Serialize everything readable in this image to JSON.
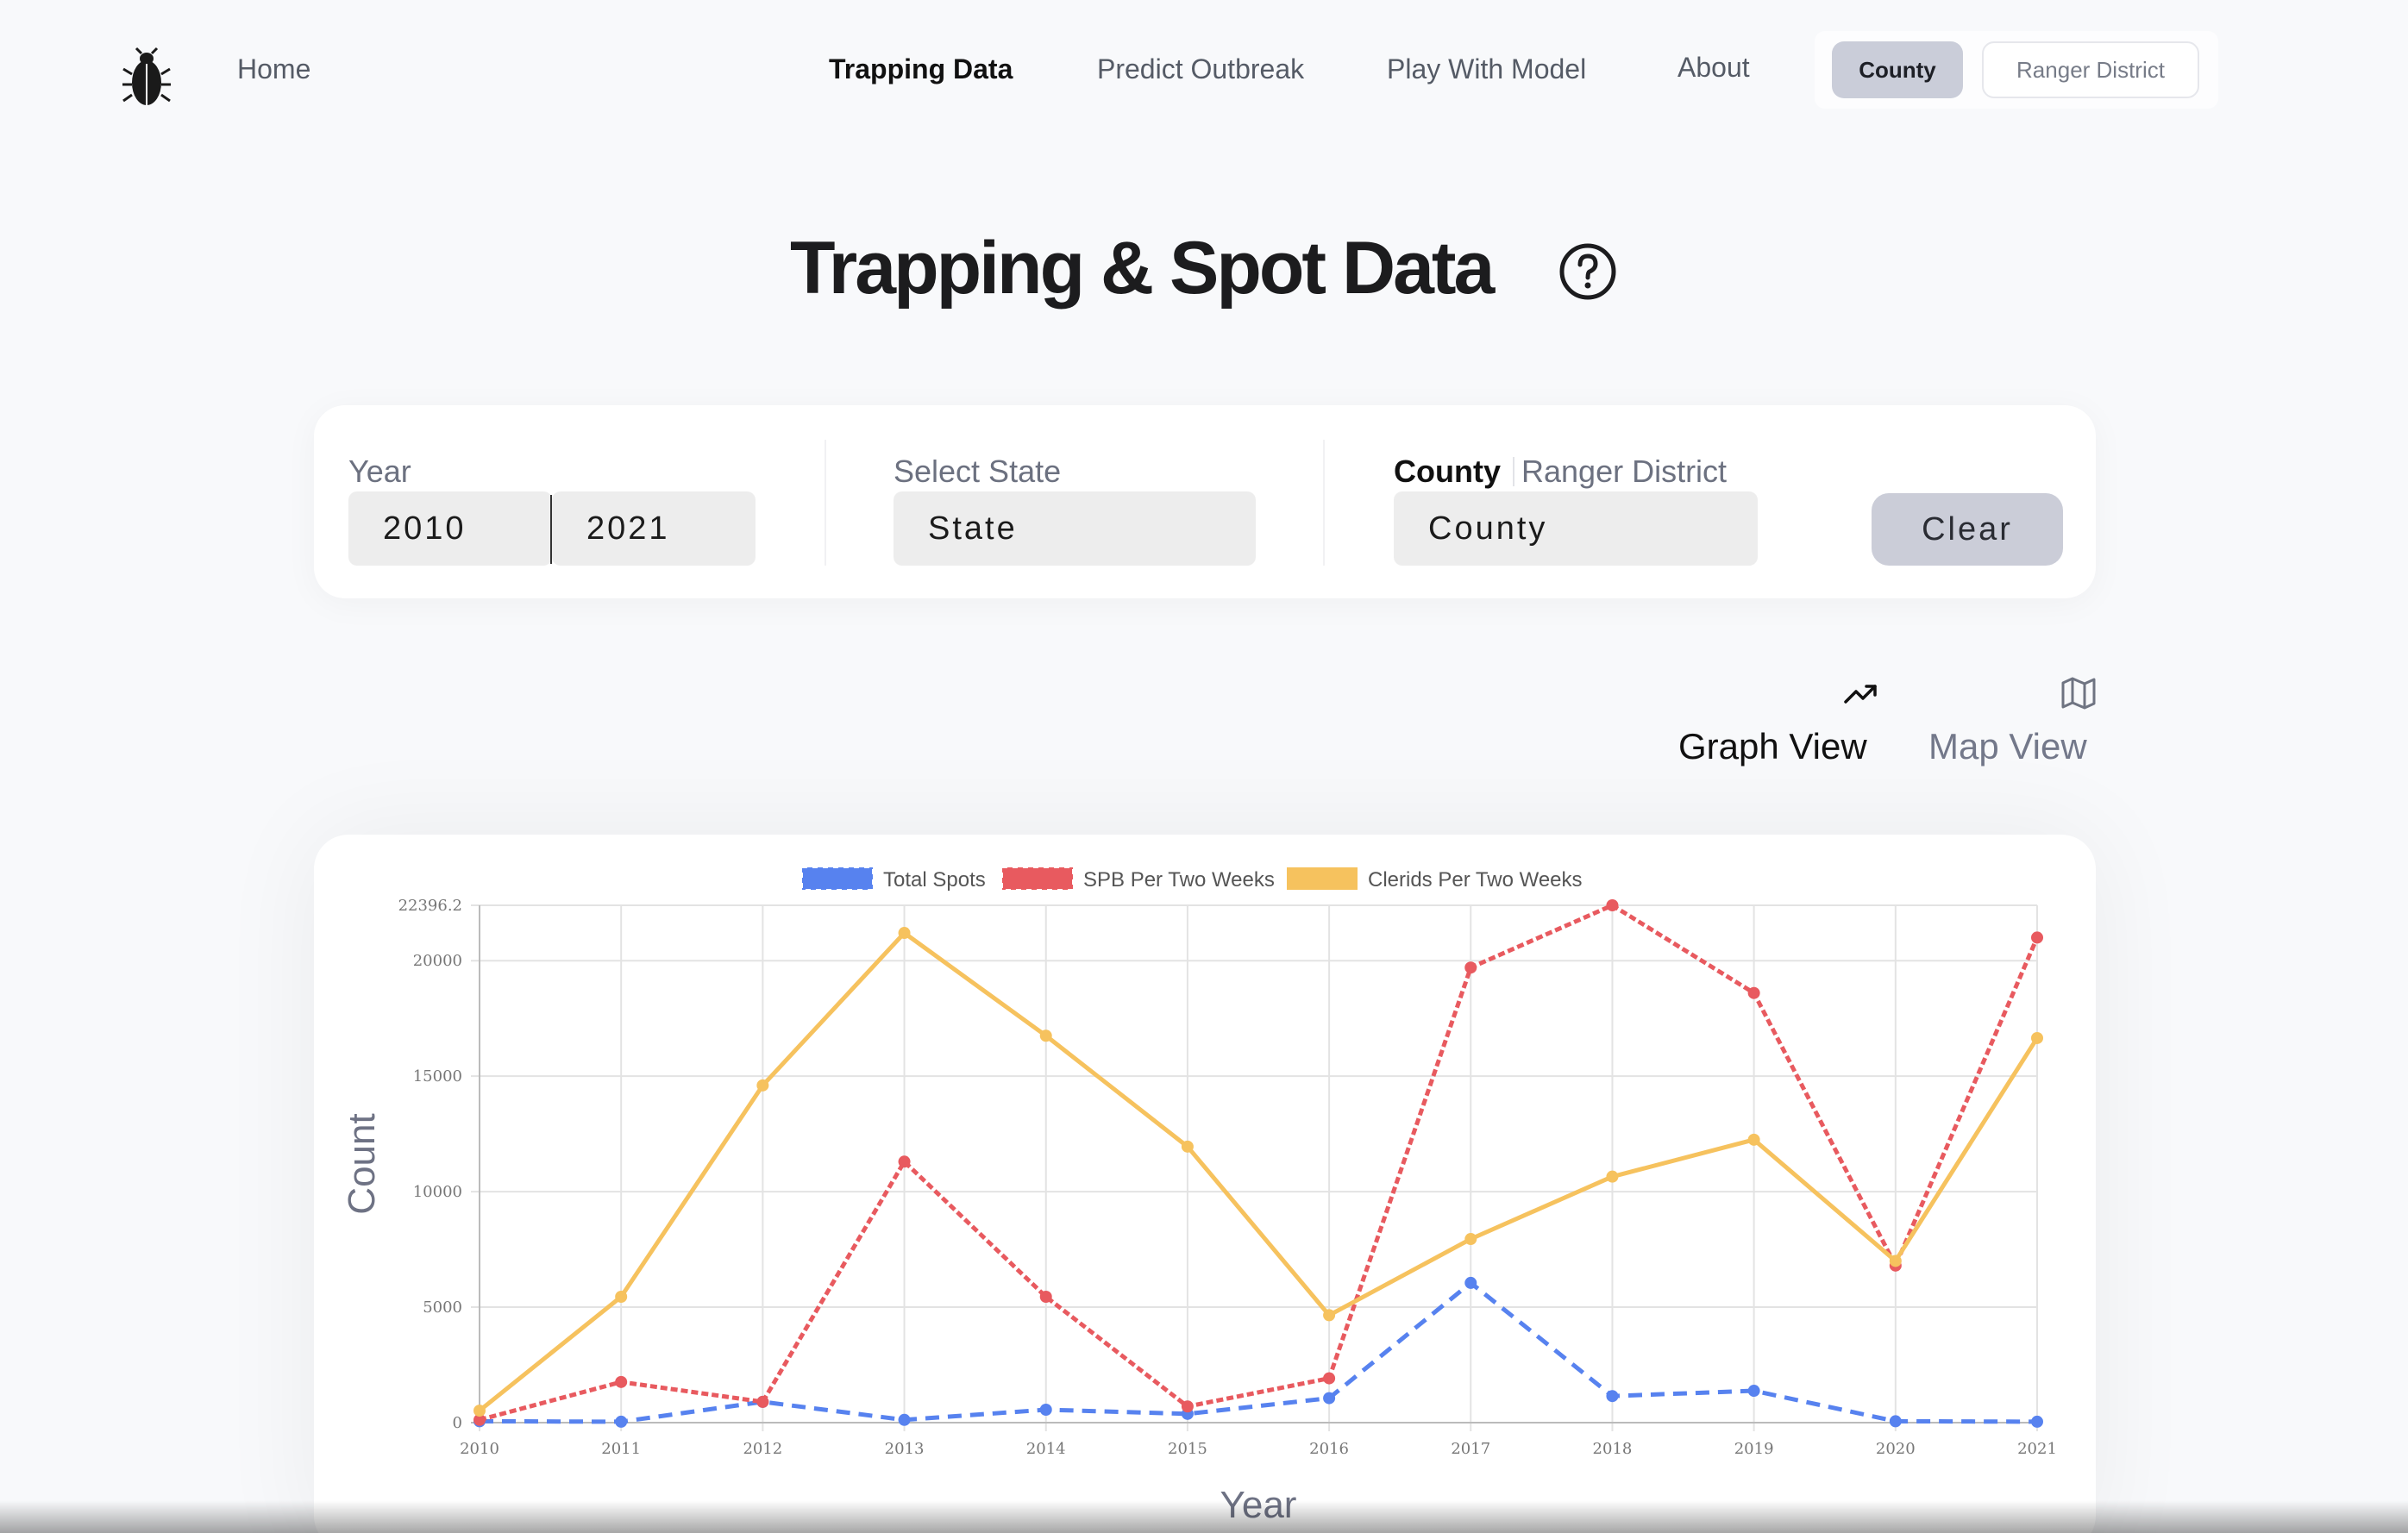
{
  "nav": {
    "home": "Home",
    "links": [
      "Trapping Data",
      "Predict Outbreak",
      "Play With Model",
      "About"
    ],
    "active": "Trapping Data",
    "toggle": {
      "on": "County",
      "off": "Ranger District"
    }
  },
  "page": {
    "title": "Trapping & Spot Data",
    "help_icon": "question-circle-icon"
  },
  "filters": {
    "year_label": "Year",
    "year_start": "2010",
    "year_end": "2021",
    "state_label": "Select State",
    "state_placeholder": "State",
    "county_tab": "County",
    "ranger_tab": "Ranger District",
    "county_placeholder": "County",
    "clear_label": "Clear"
  },
  "views": {
    "graph": {
      "label": "Graph View",
      "icon": "trending-up-icon"
    },
    "map": {
      "label": "Map View",
      "icon": "map-icon"
    },
    "active": "graph"
  },
  "chart_data": {
    "type": "line",
    "x": [
      2010,
      2011,
      2012,
      2013,
      2014,
      2015,
      2016,
      2017,
      2018,
      2019,
      2020,
      2021
    ],
    "series": [
      {
        "name": "Total Spots",
        "color": "#5782ef",
        "dashed": true,
        "values": [
          60,
          40,
          900,
          120,
          560,
          380,
          1060,
          6050,
          1150,
          1380,
          60,
          40
        ]
      },
      {
        "name": "SPB Per Two Weeks",
        "color": "#e85a5f",
        "dashed": true,
        "values": [
          120,
          1760,
          900,
          11300,
          5450,
          700,
          1920,
          19700,
          22396.2,
          18600,
          6800,
          21000
        ]
      },
      {
        "name": "Clerids Per Two Weeks",
        "color": "#f6c25e",
        "dashed": false,
        "values": [
          520,
          5450,
          14600,
          21200,
          16750,
          11950,
          4650,
          7950,
          10650,
          12250,
          7000,
          16650
        ]
      }
    ],
    "xlabel": "Year",
    "ylabel": "Count",
    "ylim": [
      0,
      22396.2
    ],
    "yticks": [
      0,
      5000,
      10000,
      15000,
      20000,
      22396.2
    ],
    "grid": true,
    "legend": "top-center"
  }
}
